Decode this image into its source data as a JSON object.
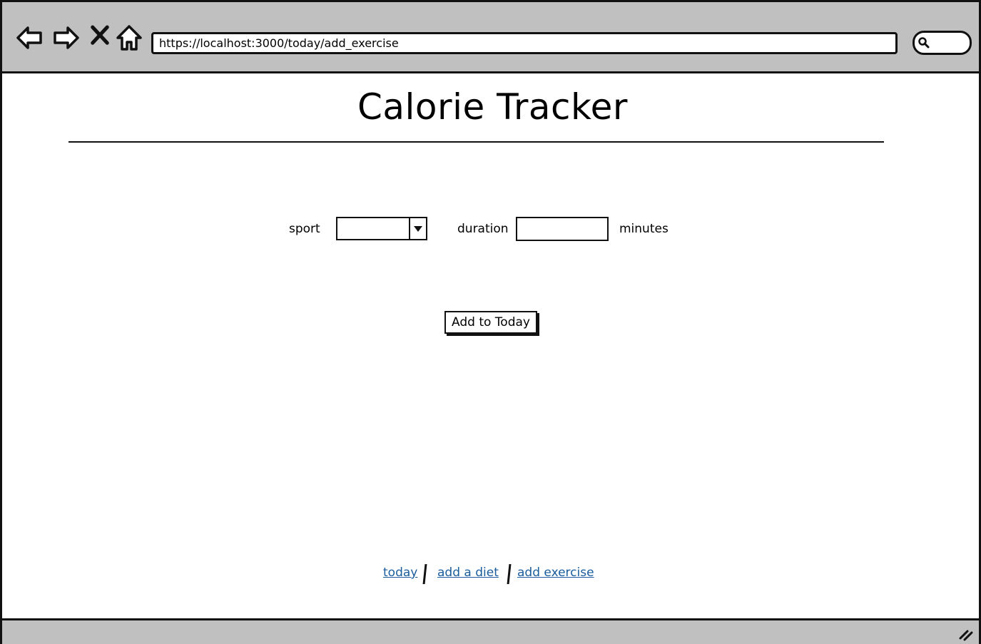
{
  "browser": {
    "url": "https://localhost:3000/today/add_exercise",
    "icons": [
      "back-arrow-icon",
      "forward-arrow-icon",
      "close-icon",
      "home-icon",
      "search-icon",
      "resize-grip-icon"
    ]
  },
  "header": {
    "title": "Calorie Tracker"
  },
  "form": {
    "sport_label": "sport",
    "sport_value": "",
    "duration_label": "duration",
    "duration_value": "",
    "minutes_label": "minutes",
    "submit_label": "Add to Today"
  },
  "footer": {
    "links": [
      {
        "label": "today"
      },
      {
        "label": "add a diet"
      },
      {
        "label": "add exercise"
      }
    ]
  },
  "colors": {
    "chrome": "#c0c0c0",
    "link": "#1a5c9c",
    "ink": "#111111"
  }
}
